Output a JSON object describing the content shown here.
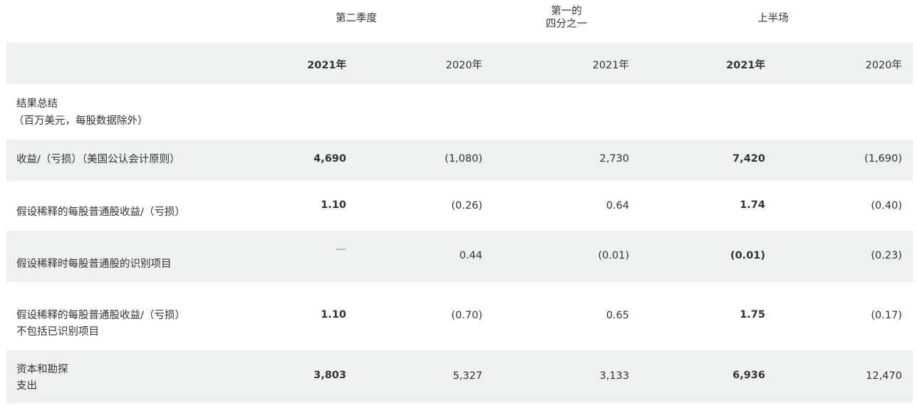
{
  "group_headers": {
    "q2": "第二季度",
    "q1_line1": "第一的",
    "q1_line2": "四分之一",
    "h1": "上半场"
  },
  "years": [
    "2021年",
    "2020年",
    "2021年",
    "2021年",
    "2020年"
  ],
  "section": {
    "title": "结果总结",
    "subtitle": "（百万美元，每股数据除外）"
  },
  "rows": [
    {
      "label_line1": "收益/（亏损）（美国公认会计原则）",
      "label_line2": "",
      "values": [
        "4,690",
        "(1,080)",
        "2,730",
        "7,420",
        "(1,690)"
      ]
    },
    {
      "label_line1": "假设稀释的每股普通股收益/（亏损）",
      "label_line2": "",
      "values": [
        "1.10",
        "(0.26)",
        "0.64",
        "1.74",
        "(0.40)"
      ]
    },
    {
      "label_line1": "假设稀释时每股普通股的识别项目",
      "label_line2": "",
      "values": [
        "—",
        "0.44",
        "(0.01)",
        "(0.01)",
        "(0.23)"
      ]
    },
    {
      "label_line1": "假设稀释的每股普通股收益/（亏损）",
      "label_line2": "不包括已识别项目",
      "values": [
        "1.10",
        "(0.70)",
        "0.65",
        "1.75",
        "(0.17)"
      ]
    },
    {
      "label_line1": "资本和勘探",
      "label_line2": "支出",
      "values": [
        "3,803",
        "5,327",
        "3,133",
        "6,936",
        "12,470"
      ]
    }
  ]
}
